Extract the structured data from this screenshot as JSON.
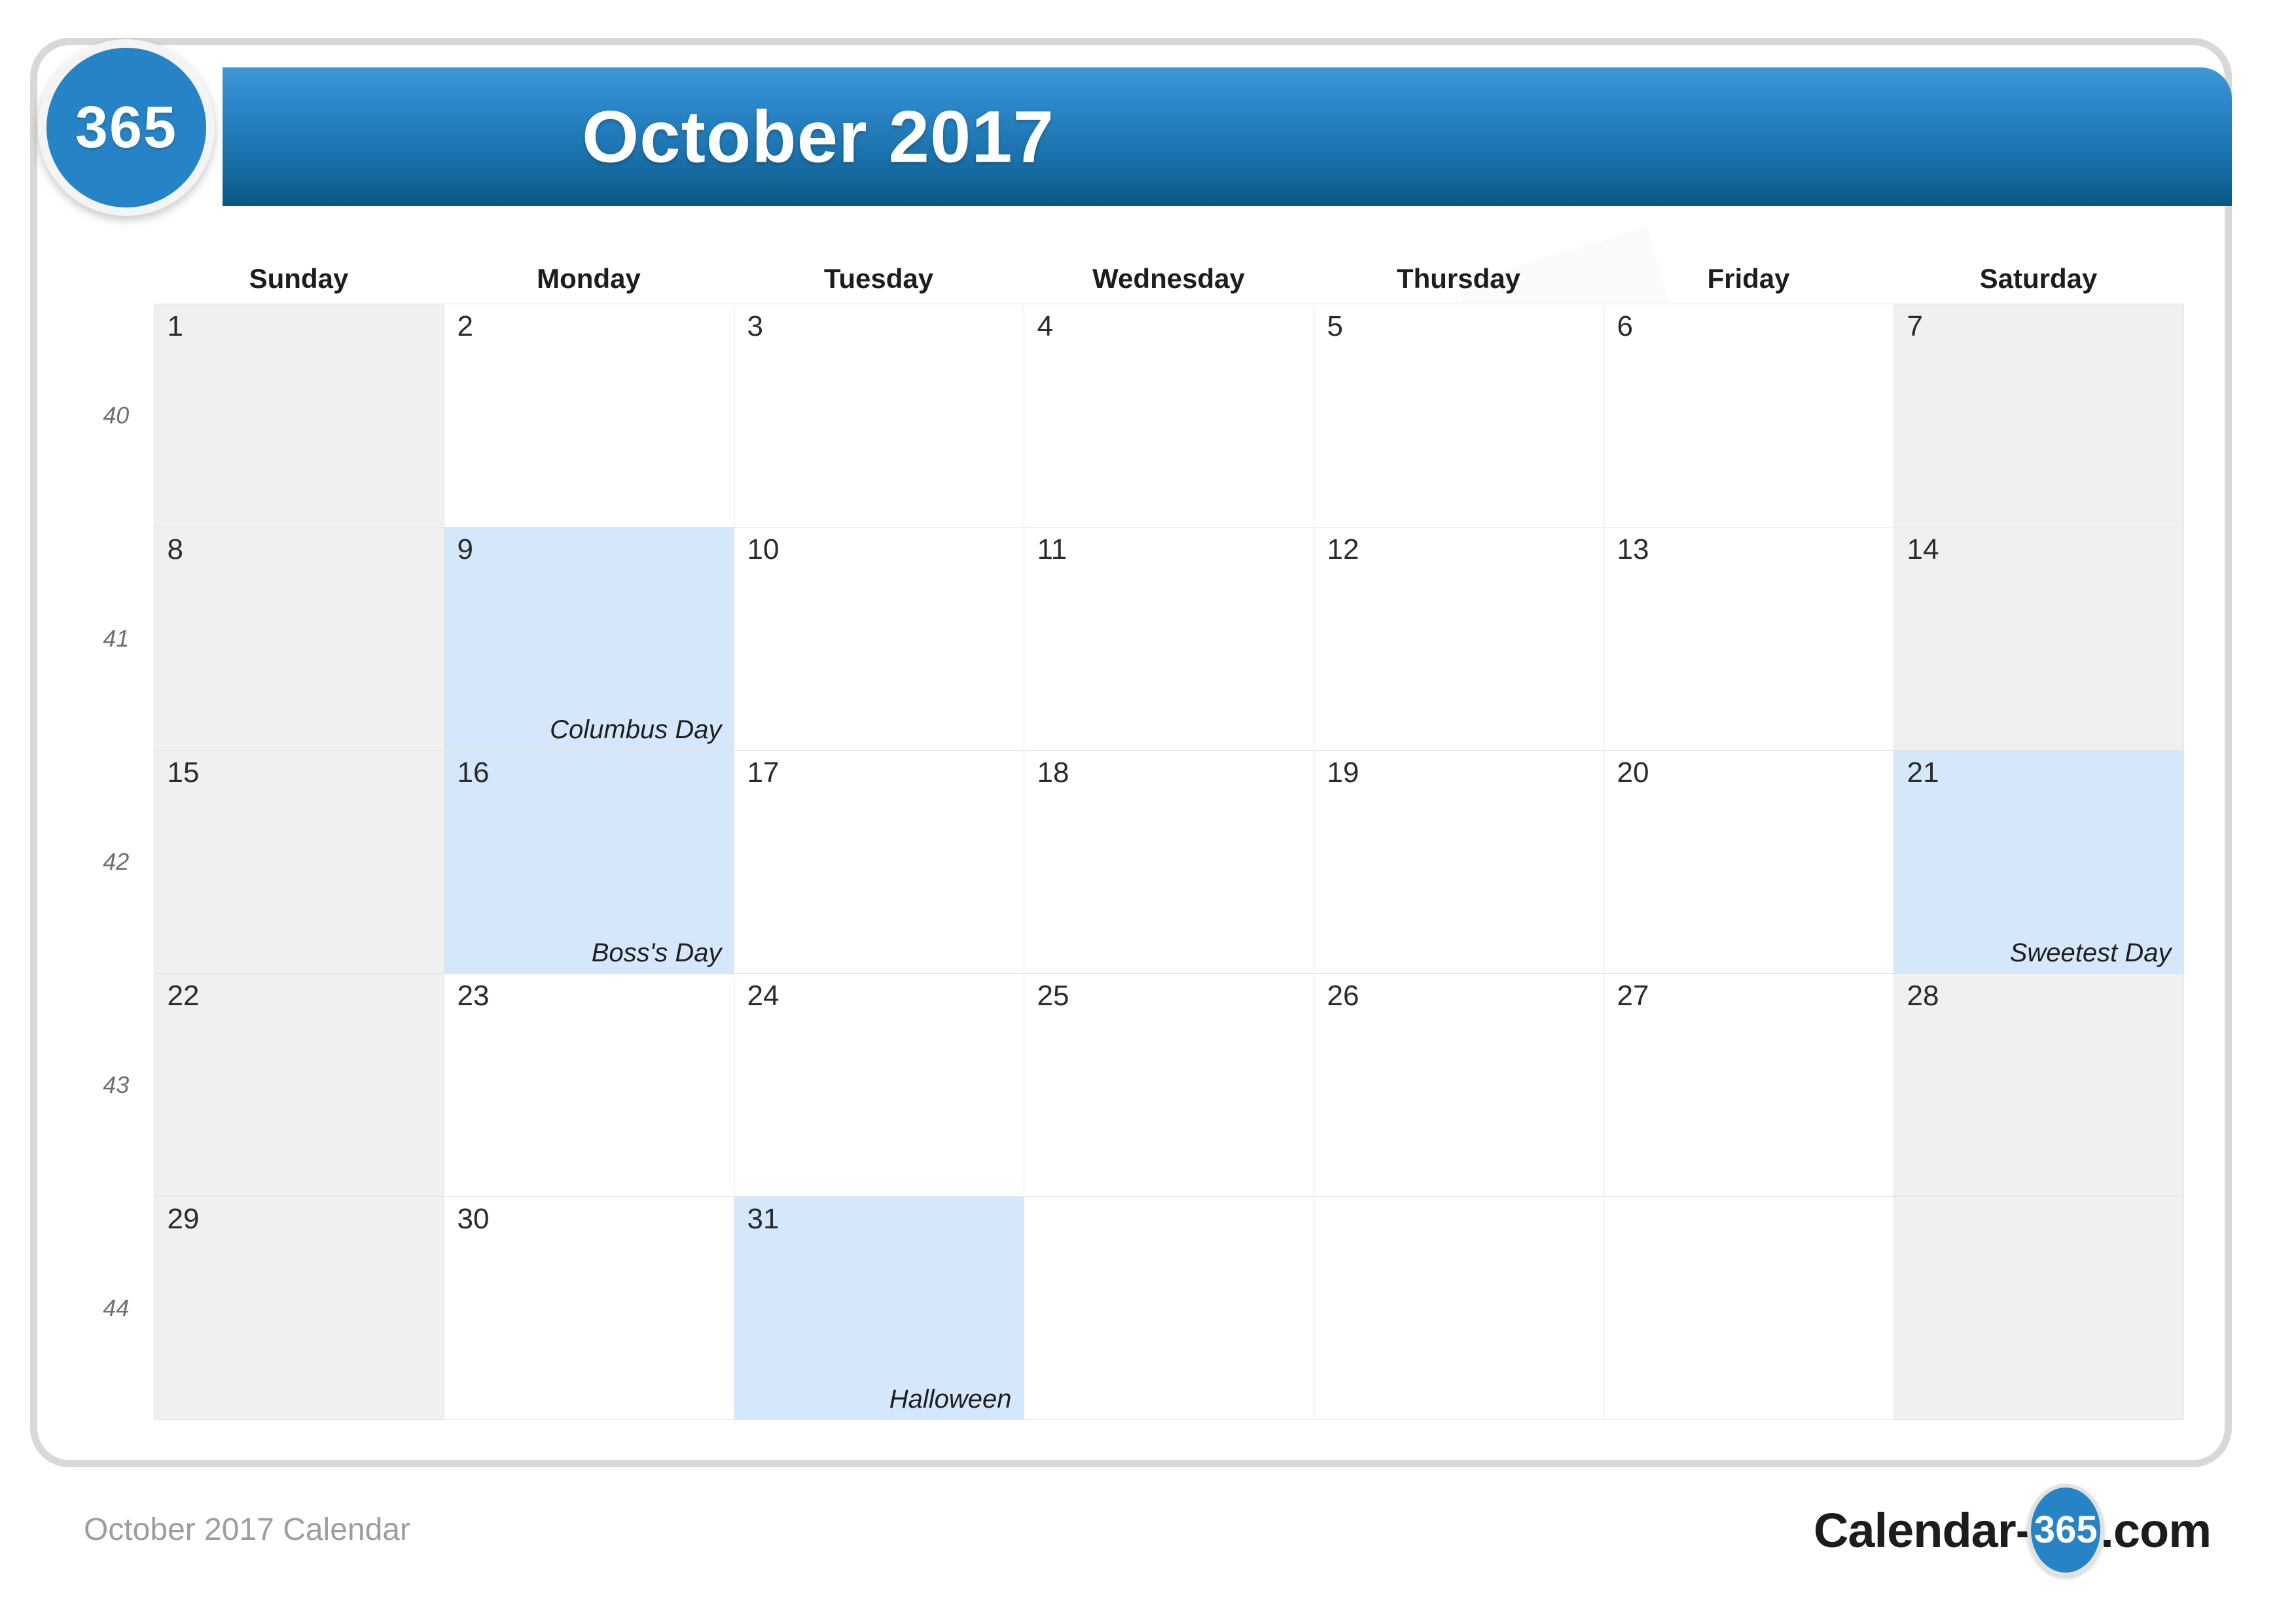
{
  "header": {
    "title": "October 2017",
    "badge_label": "365",
    "watermark_text": "365"
  },
  "colors": {
    "header_top": "#3d97d8",
    "header_bottom": "#0a567f",
    "badge_blue": "#2583c6",
    "holiday_bg": "#d5e8fb",
    "weekend_bg": "#f0f0f0",
    "frame_border": "#d8d8d8",
    "grid_line": "#e3e3e3"
  },
  "calendar": {
    "week_column_header": "",
    "day_headers": [
      "Sunday",
      "Monday",
      "Tuesday",
      "Wednesday",
      "Thursday",
      "Friday",
      "Saturday"
    ],
    "weeks": [
      {
        "week_number": "40",
        "days": [
          {
            "num": "1",
            "weekend": true,
            "holiday": null
          },
          {
            "num": "2",
            "weekend": false,
            "holiday": null
          },
          {
            "num": "3",
            "weekend": false,
            "holiday": null
          },
          {
            "num": "4",
            "weekend": false,
            "holiday": null
          },
          {
            "num": "5",
            "weekend": false,
            "holiday": null
          },
          {
            "num": "6",
            "weekend": false,
            "holiday": null
          },
          {
            "num": "7",
            "weekend": true,
            "holiday": null
          }
        ]
      },
      {
        "week_number": "41",
        "days": [
          {
            "num": "8",
            "weekend": true,
            "holiday": null
          },
          {
            "num": "9",
            "weekend": false,
            "holiday": "Columbus Day"
          },
          {
            "num": "10",
            "weekend": false,
            "holiday": null
          },
          {
            "num": "11",
            "weekend": false,
            "holiday": null
          },
          {
            "num": "12",
            "weekend": false,
            "holiday": null
          },
          {
            "num": "13",
            "weekend": false,
            "holiday": null
          },
          {
            "num": "14",
            "weekend": true,
            "holiday": null
          }
        ]
      },
      {
        "week_number": "42",
        "days": [
          {
            "num": "15",
            "weekend": true,
            "holiday": null
          },
          {
            "num": "16",
            "weekend": false,
            "holiday": "Boss's Day"
          },
          {
            "num": "17",
            "weekend": false,
            "holiday": null
          },
          {
            "num": "18",
            "weekend": false,
            "holiday": null
          },
          {
            "num": "19",
            "weekend": false,
            "holiday": null
          },
          {
            "num": "20",
            "weekend": false,
            "holiday": null
          },
          {
            "num": "21",
            "weekend": true,
            "holiday": "Sweetest Day"
          }
        ]
      },
      {
        "week_number": "43",
        "days": [
          {
            "num": "22",
            "weekend": true,
            "holiday": null
          },
          {
            "num": "23",
            "weekend": false,
            "holiday": null
          },
          {
            "num": "24",
            "weekend": false,
            "holiday": null
          },
          {
            "num": "25",
            "weekend": false,
            "holiday": null
          },
          {
            "num": "26",
            "weekend": false,
            "holiday": null
          },
          {
            "num": "27",
            "weekend": false,
            "holiday": null
          },
          {
            "num": "28",
            "weekend": true,
            "holiday": null
          }
        ]
      },
      {
        "week_number": "44",
        "days": [
          {
            "num": "29",
            "weekend": true,
            "holiday": null
          },
          {
            "num": "30",
            "weekend": false,
            "holiday": null
          },
          {
            "num": "31",
            "weekend": false,
            "holiday": "Halloween"
          },
          {
            "num": "",
            "weekend": false,
            "holiday": null
          },
          {
            "num": "",
            "weekend": false,
            "holiday": null
          },
          {
            "num": "",
            "weekend": false,
            "holiday": null
          },
          {
            "num": "",
            "weekend": true,
            "holiday": null
          }
        ]
      }
    ]
  },
  "footer": {
    "caption": "October 2017 Calendar",
    "logo_prefix": "Calendar-",
    "logo_badge": "365",
    "logo_suffix": ".com"
  }
}
